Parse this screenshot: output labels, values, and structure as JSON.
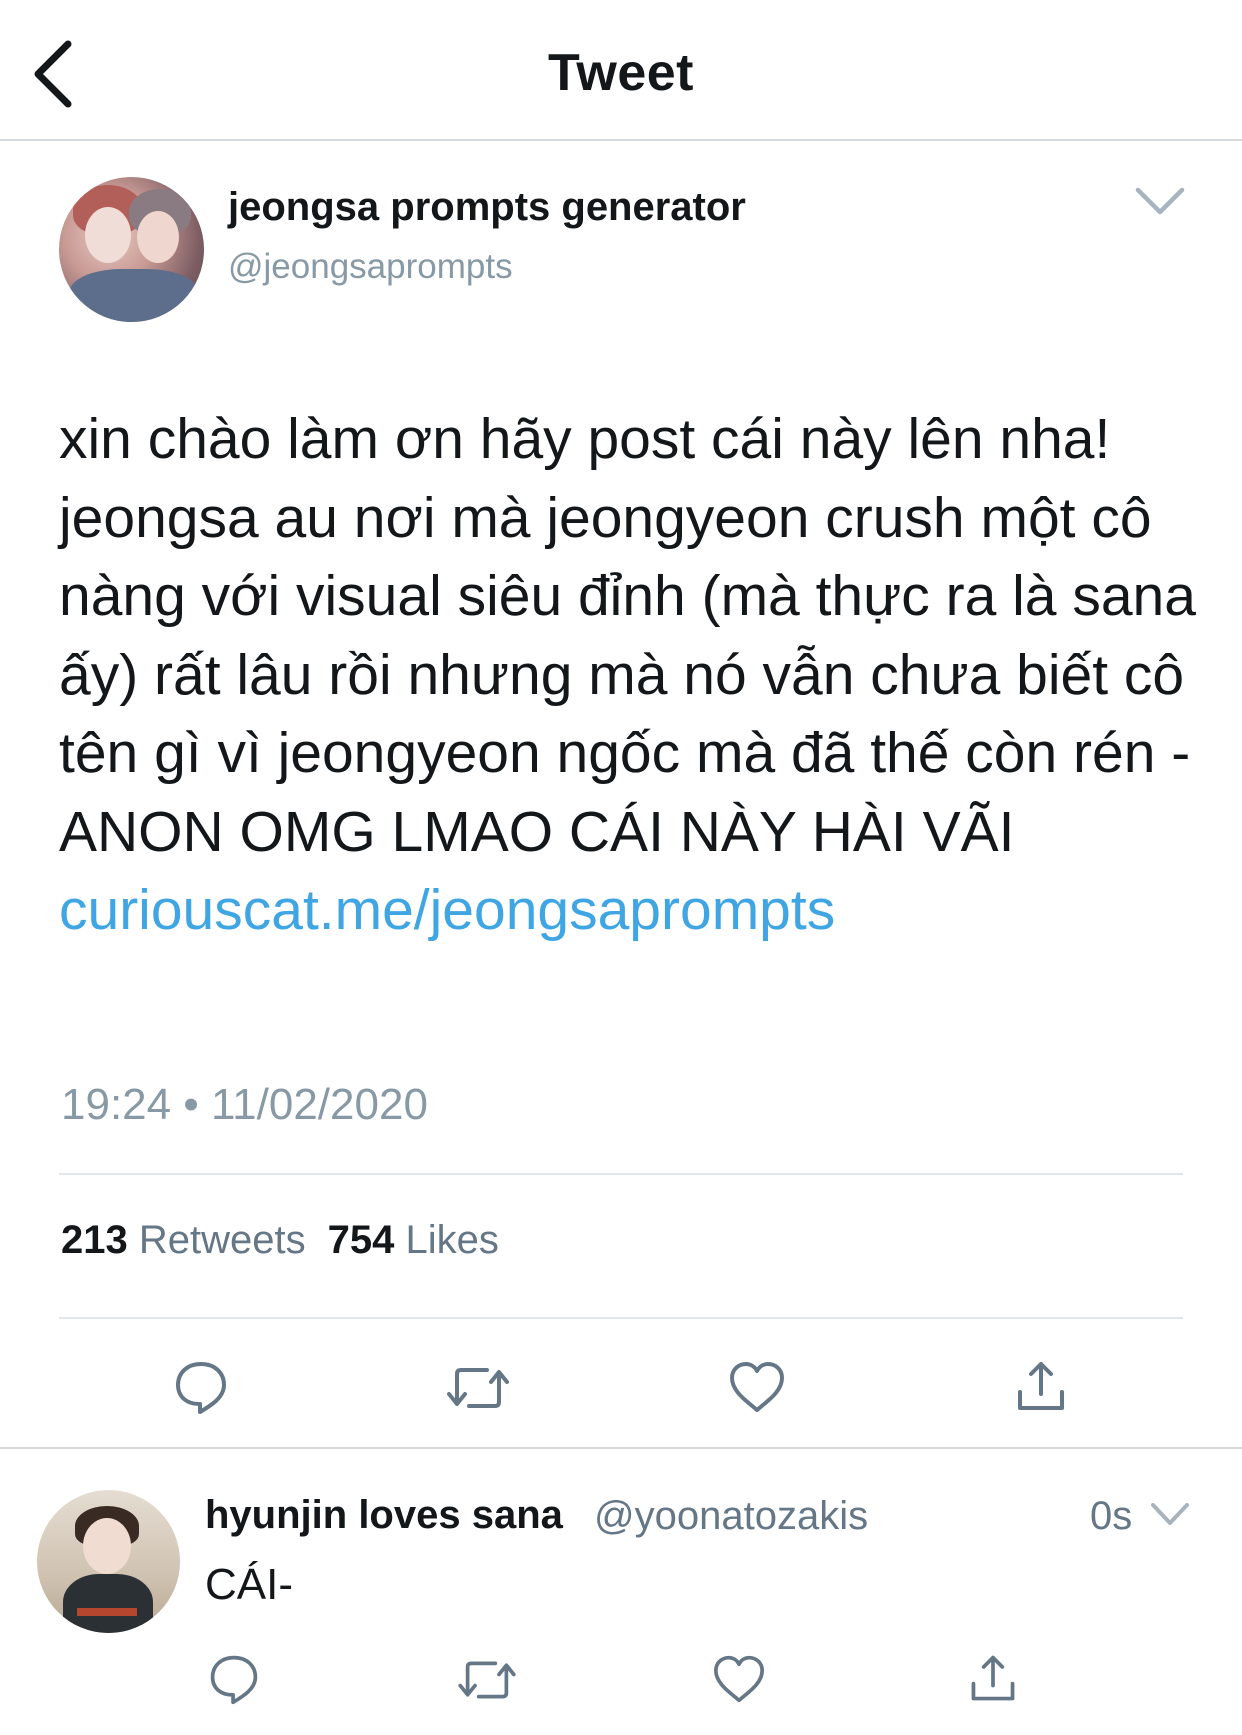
{
  "header": {
    "title": "Tweet",
    "back_icon": "chevron-left-icon"
  },
  "tweet": {
    "author_name": "jeongsa prompts generator",
    "author_handle": "@jeongsaprompts",
    "text": "xin chào làm ơn hãy post cái này lên nha! jeongsa au nơi mà jeongyeon crush một cô nàng với visual siêu đỉnh (mà thực ra là sana ấy) rất lâu rồi nhưng mà nó vẫn chưa biết cô tên gì vì jeongyeon ngốc mà đã thế còn rén - ANON OMG LMAO CÁI NÀY HÀI VÃI",
    "link": "curiouscat.me/jeongsaprompts",
    "timestamp": "19:24 • 11/02/2020",
    "retweets_count": "213",
    "retweets_label": "Retweets",
    "likes_count": "754",
    "likes_label": "Likes"
  },
  "reply": {
    "author_name": "hyunjin loves sana",
    "author_handle": "@yoonatozakis",
    "time": "0s",
    "text": "CÁI-"
  },
  "actions": [
    "reply-icon",
    "retweet-icon",
    "like-icon",
    "share-icon"
  ],
  "colors": {
    "link": "#3fa6e3",
    "secondary_text": "#8899a6",
    "icon": "#657786",
    "divider": "#e1e6ea"
  }
}
